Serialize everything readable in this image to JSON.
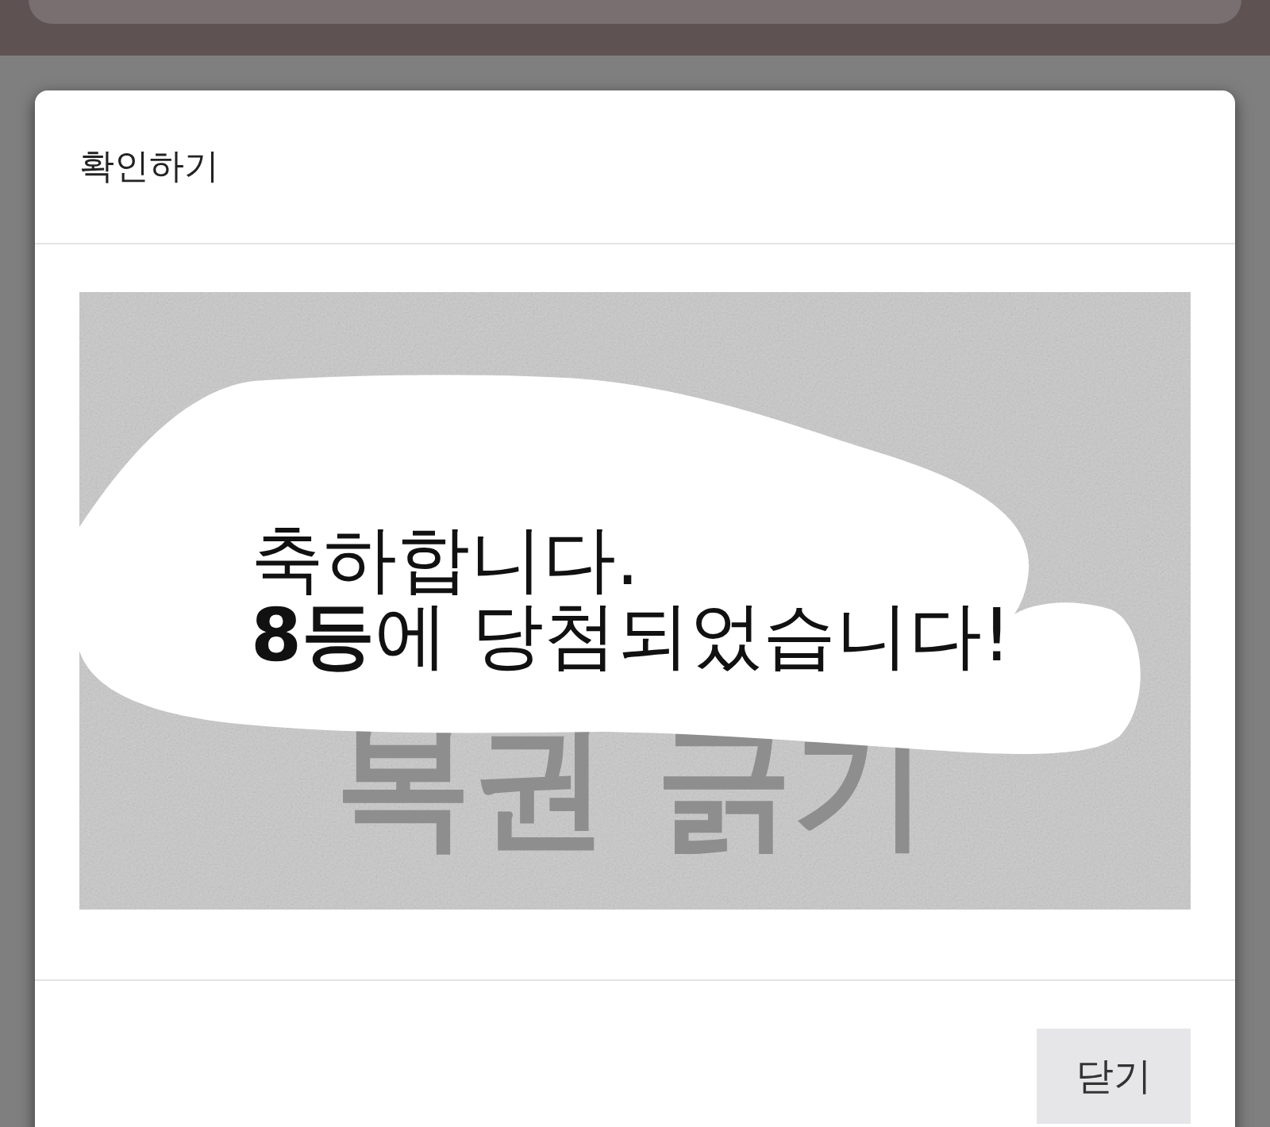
{
  "dialog": {
    "title": "확인하기",
    "scratch_card": {
      "coating_label": "복권 긁기",
      "scratched": true,
      "message": [
        "축하합니다.",
        "**8등**에 당첨되었습니다!"
      ]
    },
    "buttons": [
      {
        "label": "닫기",
        "kind": "secondary"
      }
    ]
  }
}
